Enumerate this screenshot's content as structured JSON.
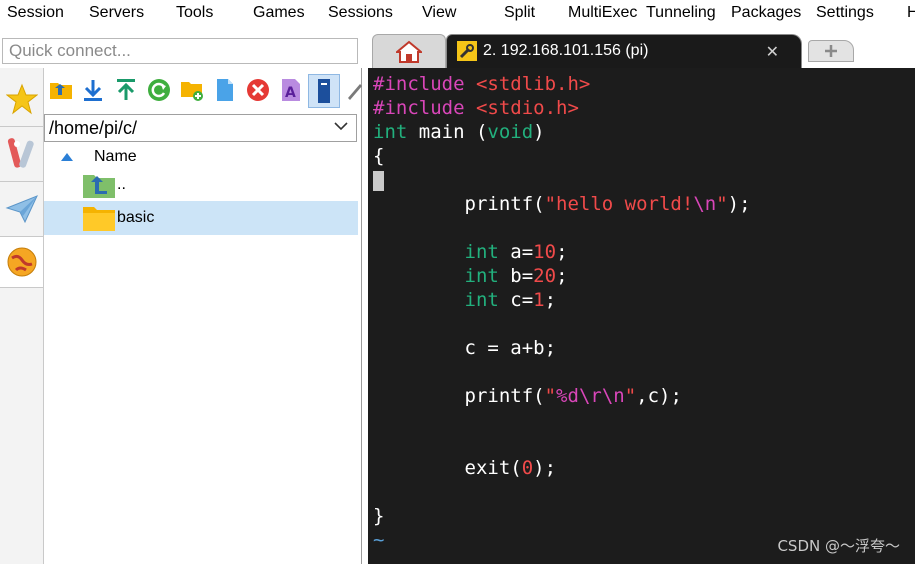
{
  "menubar": {
    "items": [
      "Session",
      "Servers",
      "Tools",
      "Games",
      "Sessions",
      "View",
      "Split",
      "MultiExec",
      "Tunneling",
      "Packages",
      "Settings",
      "H"
    ]
  },
  "quick_connect": {
    "placeholder": "Quick connect..."
  },
  "side_tabs": [
    {
      "icon": "star-icon",
      "label": "Sessions"
    },
    {
      "icon": "tools-icon",
      "label": "Tools"
    },
    {
      "icon": "paper-plane-icon",
      "label": "Macros"
    },
    {
      "icon": "globe-icon",
      "label": "SFTP"
    }
  ],
  "sftp": {
    "toolbar_icons": [
      "parent-folder-icon",
      "download-icon",
      "upload-icon",
      "refresh-icon",
      "new-folder-icon",
      "new-file-icon",
      "delete-icon",
      "rename-icon",
      "terminal-follow-icon",
      "edit-icon"
    ],
    "path": "/home/pi/c/",
    "column_header": "Name",
    "rows": [
      {
        "name": "..",
        "type": "parent"
      },
      {
        "name": "basic",
        "type": "folder",
        "selected": true
      }
    ]
  },
  "tabs": {
    "session_title": "2. 192.168.101.156 (pi)",
    "close_glyph": "✕"
  },
  "terminal": {
    "lines": [
      "#include <stdlib.h>",
      "#include <stdio.h>",
      "int main (void)",
      "{",
      "",
      "        printf(\"hello world!\\n\");",
      "",
      "        int a=10;",
      "        int b=20;",
      "        int c=1;",
      "",
      "        c = a+b;",
      "",
      "        printf(\"%d\\r\\n\",c);",
      "",
      "",
      "        exit(0);",
      "",
      "}",
      "~"
    ]
  },
  "watermark": "CSDN @～浮夸～",
  "colors": {
    "terminal_bg": "#1c1c1c",
    "preprocessor": "#d946b9",
    "keyword": "#22b07d",
    "string": "#f04a4a",
    "selection": "#cce4f7"
  }
}
